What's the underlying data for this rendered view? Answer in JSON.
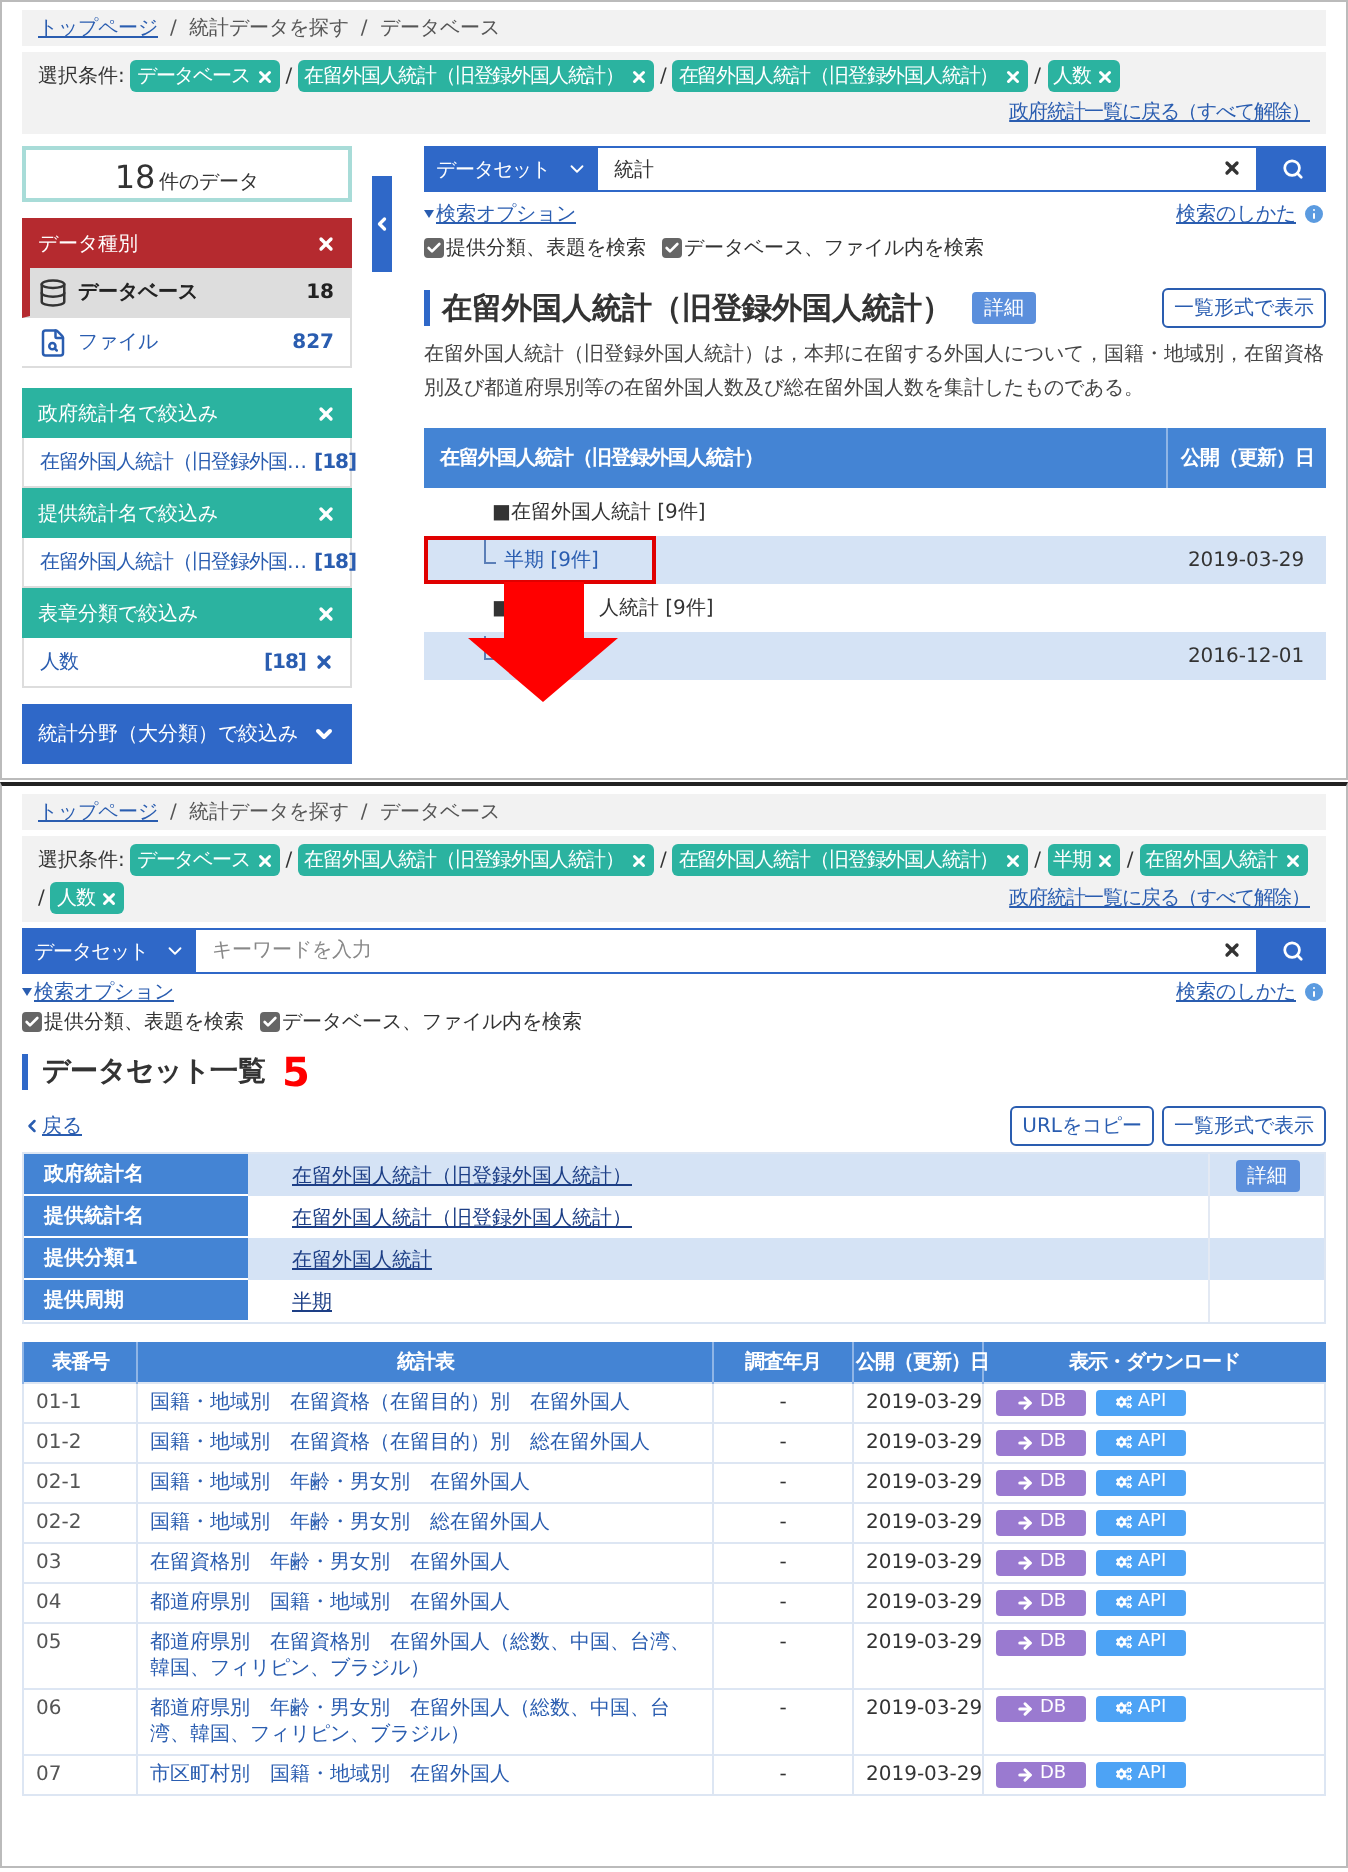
{
  "results_view": {
    "breadcrumb": {
      "separator": "/",
      "items": [
        {
          "label": "トップページ",
          "link": true
        },
        {
          "label": "統計データを探す",
          "link": false
        },
        {
          "label": "データベース",
          "link": false
        }
      ]
    },
    "conditions": {
      "label": "選択条件:",
      "separator": "/",
      "chips": [
        "データベース",
        "在留外国人統計（旧登録外国人統計）",
        "在留外国人統計（旧登録外国人統計）",
        "人数"
      ],
      "reset_link": "政府統計一覧に戻る（すべて解除）"
    },
    "sidebar": {
      "count": "18",
      "count_unit": "件のデータ",
      "data_type": {
        "title": "データ種別",
        "items": [
          {
            "kind": "database",
            "label": "データベース",
            "count": "18",
            "selected": true
          },
          {
            "kind": "file",
            "label": "ファイル",
            "count": "827",
            "selected": false
          }
        ]
      },
      "filters": [
        {
          "title": "政府統計名で絞込み",
          "items": [
            {
              "label": "在留外国人統計（旧登録外国…",
              "count": "[18]"
            }
          ]
        },
        {
          "title": "提供統計名で絞込み",
          "items": [
            {
              "label": "在留外国人統計（旧登録外国…",
              "count": "[18]"
            }
          ]
        },
        {
          "title": "表章分類で絞込み",
          "items": [
            {
              "label": "人数",
              "count": "[18]"
            }
          ]
        }
      ],
      "collapsed_filter": {
        "title": "統計分野（大分類）で絞込み",
        "expanded": false
      }
    },
    "search": {
      "type": "データセット",
      "value": "統計",
      "options_link": "検索オプション",
      "help_link": "検索のしかた",
      "checks": [
        {
          "label": "提供分類、表題を検索",
          "checked": true
        },
        {
          "label": "データベース、ファイル内を検索",
          "checked": true
        }
      ]
    },
    "title": "在留外国人統計（旧登録外国人統計）",
    "detail_badge": "詳細",
    "list_button": "一覧形式で表示",
    "description": "在留外国人統計（旧登録外国人統計）は，本邦に在留する外国人について，国籍・地域別，在留資格別及び都道府県別等の在留外国人数及び総在留外国人数を集計したものである。",
    "tree": {
      "columns": [
        "在留外国人統計（旧登録外国人統計）",
        "公開（更新）日"
      ],
      "rows": [
        {
          "kind": "group",
          "marker": "■",
          "label": "在留外国人統計 [9件]",
          "highlighted": false
        },
        {
          "kind": "leaf",
          "label": "半期 [9件]",
          "date": "2019-03-29",
          "highlighted": true
        },
        {
          "kind": "group_partly_covered",
          "marker": "■",
          "label": "人統計 [9件]",
          "highlighted": false
        },
        {
          "kind": "leaf",
          "date": "2016-12-01",
          "highlighted": false
        }
      ]
    }
  },
  "list_view": {
    "breadcrumb": {
      "separator": "/",
      "items": [
        {
          "label": "トップページ",
          "link": true
        },
        {
          "label": "統計データを探す",
          "link": false
        },
        {
          "label": "データベース",
          "link": false
        }
      ]
    },
    "conditions": {
      "label": "選択条件:",
      "separator": "/",
      "chips": [
        "データベース",
        "在留外国人統計（旧登録外国人統計）",
        "在留外国人統計（旧登録外国人統計）",
        "半期",
        "在留外国人統計",
        "人数"
      ],
      "reset_link": "政府統計一覧に戻る（すべて解除）"
    },
    "search": {
      "type": "データセット",
      "placeholder": "キーワードを入力",
      "options_link": "検索オプション",
      "help_link": "検索のしかた",
      "checks": [
        {
          "label": "提供分類、表題を検索",
          "checked": true
        },
        {
          "label": "データベース、ファイル内を検索",
          "checked": true
        }
      ]
    },
    "title": "データセット一覧",
    "count": "5",
    "back_link": "戻る",
    "buttons": [
      "URLをコピー",
      "一覧形式で表示"
    ],
    "info_rows": [
      {
        "label": "政府統計名",
        "value": "在留外国人統計（旧登録外国人統計）",
        "detail": "詳細"
      },
      {
        "label": "提供統計名",
        "value": "在留外国人統計（旧登録外国人統計）"
      },
      {
        "label": "提供分類1",
        "value": "在留外国人統計"
      },
      {
        "label": "提供周期",
        "value": "半期"
      }
    ],
    "table": {
      "columns": [
        "表番号",
        "統計表",
        "調査年月",
        "公開（更新）日",
        "表示・ダウンロード"
      ],
      "rows": [
        {
          "no": "01-1",
          "title": "国籍・地域別　在留資格（在留目的）別　在留外国人",
          "survey": "-",
          "date": "2019-03-29",
          "db": "DB",
          "api": "API"
        },
        {
          "no": "01-2",
          "title": "国籍・地域別　在留資格（在留目的）別　総在留外国人",
          "survey": "-",
          "date": "2019-03-29",
          "db": "DB",
          "api": "API"
        },
        {
          "no": "02-1",
          "title": "国籍・地域別　年齢・男女別　在留外国人",
          "survey": "-",
          "date": "2019-03-29",
          "db": "DB",
          "api": "API"
        },
        {
          "no": "02-2",
          "title": "国籍・地域別　年齢・男女別　総在留外国人",
          "survey": "-",
          "date": "2019-03-29",
          "db": "DB",
          "api": "API"
        },
        {
          "no": "03",
          "title": "在留資格別　年齢・男女別　在留外国人",
          "survey": "-",
          "date": "2019-03-29",
          "db": "DB",
          "api": "API"
        },
        {
          "no": "04",
          "title": "都道府県別　国籍・地域別　在留外国人",
          "survey": "-",
          "date": "2019-03-29",
          "db": "DB",
          "api": "API"
        },
        {
          "no": "05",
          "title": "都道府県別　在留資格別　在留外国人（総数、中国、台湾、韓国、フィリピン、ブラジル）",
          "survey": "-",
          "date": "2019-03-29",
          "db": "DB",
          "api": "API"
        },
        {
          "no": "06",
          "title": "都道府県別　年齢・男女別　在留外国人（総数、中国、台湾、韓国、フィリピン、ブラジル）",
          "survey": "-",
          "date": "2019-03-29",
          "db": "DB",
          "api": "API"
        },
        {
          "no": "07",
          "title": "市区町村別　国籍・地域別　在留外国人",
          "survey": "-",
          "date": "2019-03-29",
          "db": "DB",
          "api": "API"
        }
      ]
    }
  }
}
